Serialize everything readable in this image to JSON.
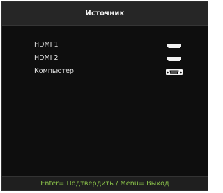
{
  "menu": {
    "title": "Источник",
    "items": [
      {
        "label": "HDMI 1",
        "icon": "hdmi-port-icon"
      },
      {
        "label": "HDMI 2",
        "icon": "hdmi-port-icon"
      },
      {
        "label": "Компьютер",
        "icon": "vga-port-icon"
      }
    ]
  },
  "hint": {
    "text": "Enter= Подтвердить / Menu= Выход",
    "color": "#8bc34a"
  },
  "colors": {
    "panel_background": "#0e0e0e",
    "title_background": "#262626",
    "text": "#e2e2e2"
  }
}
